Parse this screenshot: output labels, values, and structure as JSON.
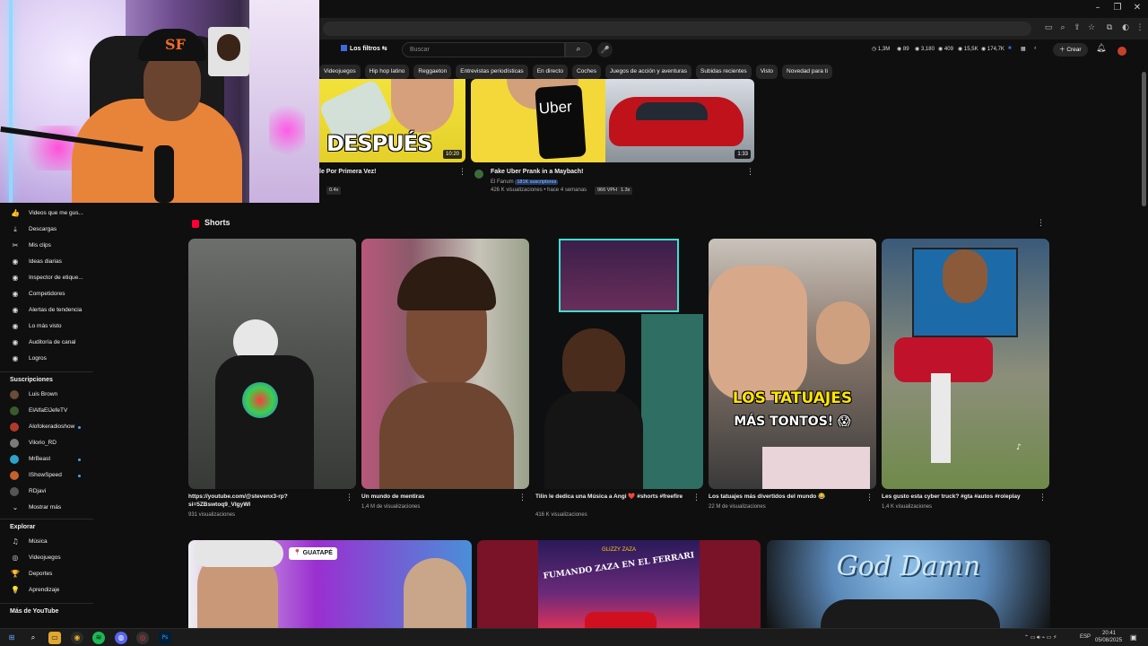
{
  "colors": {
    "bg": "#0f0f0f",
    "accent": "#3ea6ff",
    "shorts_red": "#ff0033"
  },
  "topbar": {
    "filters_label": "Los filtros",
    "search_placeholder": "Buscar",
    "stats": [
      "1,3M",
      "89",
      "3,180",
      "409",
      "15,5K",
      "174,7K"
    ],
    "create_label": "Crear"
  },
  "chips": [
    "Videojuegos",
    "Hip hop latino",
    "Reggaeton",
    "Entrevistas periodísticas",
    "En directo",
    "Coches",
    "Juegos de acción y aventuras",
    "Subidas recientes",
    "Visto",
    "Novedad para ti"
  ],
  "top_videos": [
    {
      "thumb_text": "DESPUÉS",
      "duration": "10:20",
      "title": "le Por Primera Vez!",
      "pill": "0.4x"
    },
    {
      "thumb_text": "Uber",
      "duration": "1:33",
      "title": "Fake Uber Prank in a Maybach!",
      "channel": "El Fanum",
      "subs": "181K suscriptores",
      "stats": "426 K visualizaciones • hace 4 semanas",
      "vph": "966 VPH",
      "ratio": "1.3x"
    }
  ],
  "sidebar": {
    "items": [
      {
        "icon": "thumbs-up-icon",
        "glyph": "👍",
        "label": "Videos que me gus..."
      },
      {
        "icon": "download-icon",
        "glyph": "⤓",
        "label": "Descargas"
      },
      {
        "icon": "scissors-icon",
        "glyph": "✂",
        "label": "Mis clips"
      },
      {
        "icon": "ideas-icon",
        "glyph": "◉",
        "label": "Ideas diarias"
      },
      {
        "icon": "inspector-icon",
        "glyph": "◉",
        "label": "Inspector de etique..."
      },
      {
        "icon": "competitors-icon",
        "glyph": "◉",
        "label": "Competidores"
      },
      {
        "icon": "trend-icon",
        "glyph": "◉",
        "label": "Alertas de tendencia"
      },
      {
        "icon": "most-viewed-icon",
        "glyph": "◉",
        "label": "Lo más visto"
      },
      {
        "icon": "audit-icon",
        "glyph": "◉",
        "label": "Auditoría de canal"
      },
      {
        "icon": "achievements-icon",
        "glyph": "◉",
        "label": "Logros"
      }
    ],
    "subs_heading": "Suscripciones",
    "subs": [
      {
        "name": "Luis Brown",
        "color": "#6b4b3a",
        "dot": false
      },
      {
        "name": "ElAlfaElJefeTV",
        "color": "#3b5a2e",
        "dot": false
      },
      {
        "name": "Alofokeradioshow",
        "color": "#b23a2a",
        "dot": true
      },
      {
        "name": "Vilorio_RD",
        "color": "#7a7a7a",
        "dot": false
      },
      {
        "name": "MrBeast",
        "color": "#2aa4c8",
        "dot": true
      },
      {
        "name": "IShowSpeed",
        "color": "#c8612a",
        "dot": true
      },
      {
        "name": "RDjavi",
        "color": "#555555",
        "dot": false
      }
    ],
    "show_more": "Mostrar más",
    "explore_heading": "Explorar",
    "explore": [
      {
        "icon": "music-icon",
        "glyph": "♫",
        "label": "Música"
      },
      {
        "icon": "gamepad-icon",
        "glyph": "◎",
        "label": "Videojuegos"
      },
      {
        "icon": "trophy-icon",
        "glyph": "🏆",
        "label": "Deportes"
      },
      {
        "icon": "bulb-icon",
        "glyph": "💡",
        "label": "Aprendizaje"
      }
    ],
    "more_heading": "Más de YouTube"
  },
  "shorts": {
    "heading": "Shorts",
    "items": [
      {
        "title": "https://youtube.com/@stevenx3-rp?si=5ZBswtoq9_VIgyWI",
        "views": "931 visualizaciones"
      },
      {
        "title": "Un mundo de mentiras",
        "views": "1,4 M de visualizaciones"
      },
      {
        "title": "Tilin le dedica una Música a Angi ❤️ #shorts #freefire",
        "views": "416 K visualizaciones"
      },
      {
        "title": "Los tatuajes más divertidos del mundo 😂",
        "views": "22 M de visualizaciones",
        "overlay1": "LOS TATUAJES",
        "overlay2": "MÁS TONTOS! 😱"
      },
      {
        "title": "Les gusto esta cyber truck? #gta #autos #roleplay",
        "views": "1,4 K visualizaciones"
      }
    ]
  },
  "bottom": [
    {
      "tag": "GUATAPÉ"
    },
    {
      "tag": "FUMANDO ZAZA EN EL FERRARI",
      "small": "GLIZZY ZAZA"
    },
    {
      "tag": "God Damn"
    }
  ],
  "taskbar": {
    "lang": "ESP",
    "time": "20:41",
    "date": "05/08/2025"
  }
}
